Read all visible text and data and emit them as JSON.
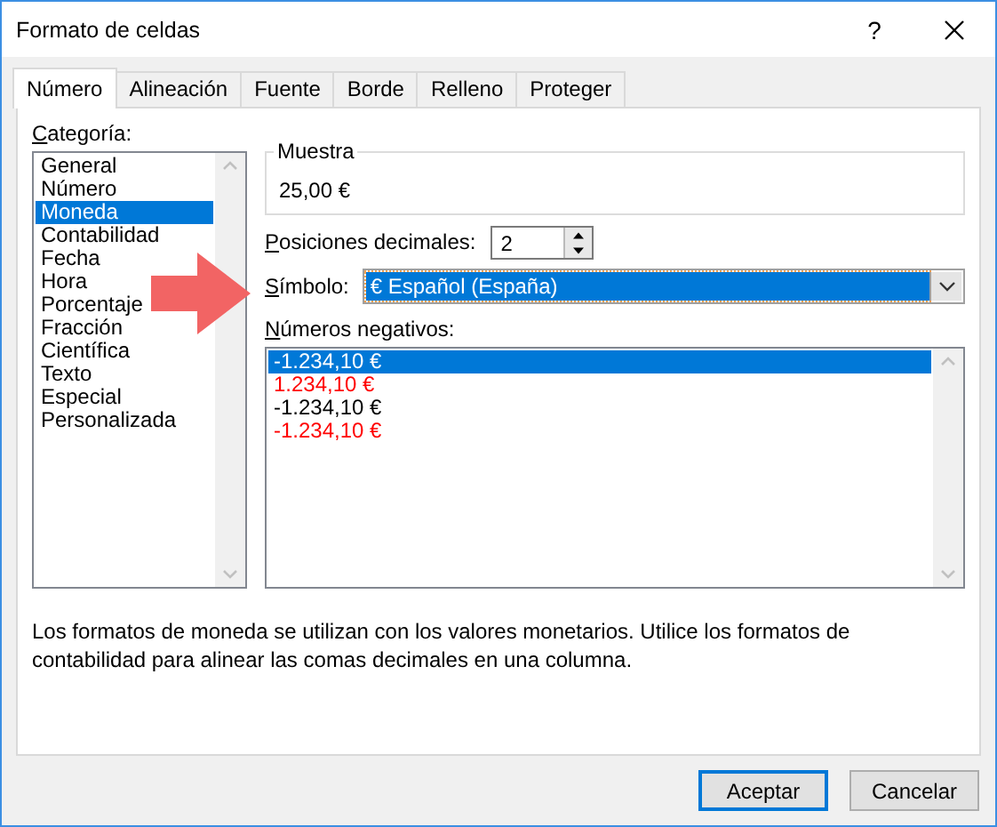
{
  "window": {
    "title": "Formato de celdas",
    "help": "?"
  },
  "tabs": [
    {
      "label": "Número",
      "selected": true
    },
    {
      "label": "Alineación",
      "selected": false
    },
    {
      "label": "Fuente",
      "selected": false
    },
    {
      "label": "Borde",
      "selected": false
    },
    {
      "label": "Relleno",
      "selected": false
    },
    {
      "label": "Proteger",
      "selected": false
    }
  ],
  "category": {
    "label": "Categoría:",
    "items": [
      {
        "label": "General",
        "selected": false
      },
      {
        "label": "Número",
        "selected": false
      },
      {
        "label": "Moneda",
        "selected": true
      },
      {
        "label": "Contabilidad",
        "selected": false
      },
      {
        "label": "Fecha",
        "selected": false
      },
      {
        "label": "Hora",
        "selected": false
      },
      {
        "label": "Porcentaje",
        "selected": false
      },
      {
        "label": "Fracción",
        "selected": false
      },
      {
        "label": "Científica",
        "selected": false
      },
      {
        "label": "Texto",
        "selected": false
      },
      {
        "label": "Especial",
        "selected": false
      },
      {
        "label": "Personalizada",
        "selected": false
      }
    ]
  },
  "sample": {
    "label": "Muestra",
    "value": "25,00 €"
  },
  "decimals": {
    "label": "Posiciones decimales:",
    "value": "2"
  },
  "symbol": {
    "label": "Símbolo:",
    "value": "€ Español (España)"
  },
  "negatives": {
    "label": "Números negativos:",
    "items": [
      {
        "label": "-1.234,10 €",
        "kind": "plain",
        "selected": true
      },
      {
        "label": "1.234,10 €",
        "kind": "red",
        "selected": false
      },
      {
        "label": "-1.234,10 €",
        "kind": "plain",
        "selected": false
      },
      {
        "label": "-1.234,10 €",
        "kind": "red",
        "selected": false
      }
    ]
  },
  "description": "Los formatos de moneda se utilizan con los valores monetarios. Utilice los formatos de contabilidad para alinear las comas decimales en una columna.",
  "buttons": [
    {
      "label": "Aceptar",
      "default": true
    },
    {
      "label": "Cancelar",
      "default": false
    }
  ]
}
